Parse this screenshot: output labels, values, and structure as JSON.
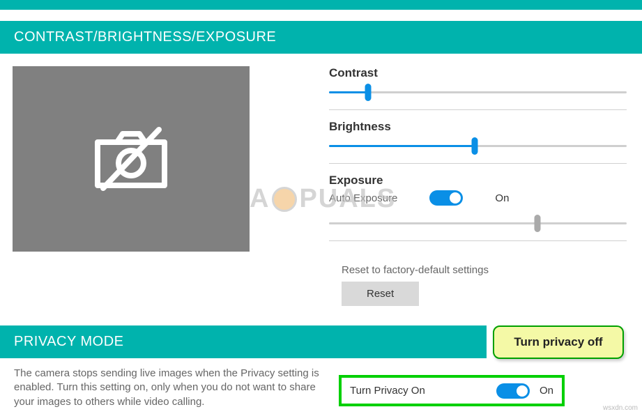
{
  "sections": {
    "contrast_brightness_exposure": {
      "title": "CONTRAST/BRIGHTNESS/EXPOSURE",
      "controls": {
        "contrast": {
          "label": "Contrast",
          "value_pct": 13
        },
        "brightness": {
          "label": "Brightness",
          "value_pct": 49
        },
        "exposure": {
          "label": "Exposure",
          "auto_label": "Auto Exposure",
          "auto_state_text": "On",
          "auto_on": true,
          "value_pct": 70,
          "disabled": true
        }
      },
      "reset": {
        "description": "Reset to factory-default settings",
        "button": "Reset"
      }
    },
    "privacy_mode": {
      "title": "PRIVACY MODE",
      "description": "The camera stops sending live images when the Privacy setting is enabled. Turn this setting on, only when you do not want to share your images to others while video calling.",
      "toggle_label": "Turn Privacy On",
      "toggle_state_text": "On",
      "toggle_on": true
    }
  },
  "callout_text": "Turn privacy off",
  "watermark_text_a": "A",
  "watermark_text_b": "PUALS",
  "source_tag": "wsxdn.com",
  "icons": {
    "no_camera": "no-camera-icon"
  },
  "colors": {
    "accent_teal": "#00b3ad",
    "accent_blue": "#0a8fe6",
    "highlight_green": "#00d000"
  }
}
